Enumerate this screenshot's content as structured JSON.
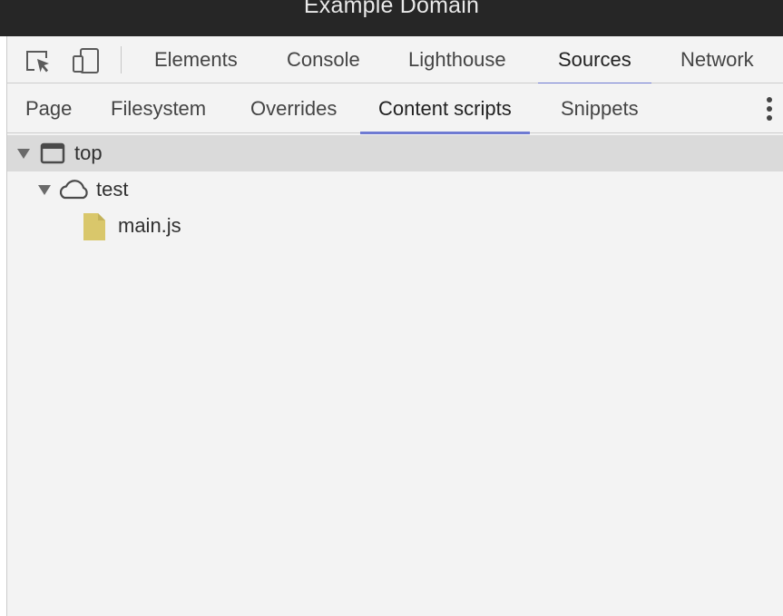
{
  "window": {
    "title": "Example Domain"
  },
  "toolbar": {
    "icons": [
      "inspect-element-icon",
      "device-toolbar-icon"
    ],
    "tabs": [
      {
        "label": "Elements",
        "active": false
      },
      {
        "label": "Console",
        "active": false
      },
      {
        "label": "Lighthouse",
        "active": false
      },
      {
        "label": "Sources",
        "active": true
      },
      {
        "label": "Network",
        "active": false
      }
    ]
  },
  "navigator": {
    "tabs": [
      {
        "label": "Page",
        "active": false
      },
      {
        "label": "Filesystem",
        "active": false
      },
      {
        "label": "Overrides",
        "active": false
      },
      {
        "label": "Content scripts",
        "active": true
      },
      {
        "label": "Snippets",
        "active": false
      }
    ],
    "more_icon": "more-vertical-icon"
  },
  "tree": {
    "top": {
      "label": "top",
      "icon": "frame-icon",
      "expanded": true,
      "selected": true
    },
    "origin": {
      "label": "test",
      "icon": "cloud-icon",
      "expanded": true
    },
    "file": {
      "label": "main.js",
      "icon": "file-icon"
    }
  },
  "colors": {
    "accent": "#6e7ad2",
    "file_icon": "#d9c76b",
    "selected_row": "#dadada",
    "panel_bg": "#f3f3f3",
    "titlebar_bg": "#262626"
  }
}
